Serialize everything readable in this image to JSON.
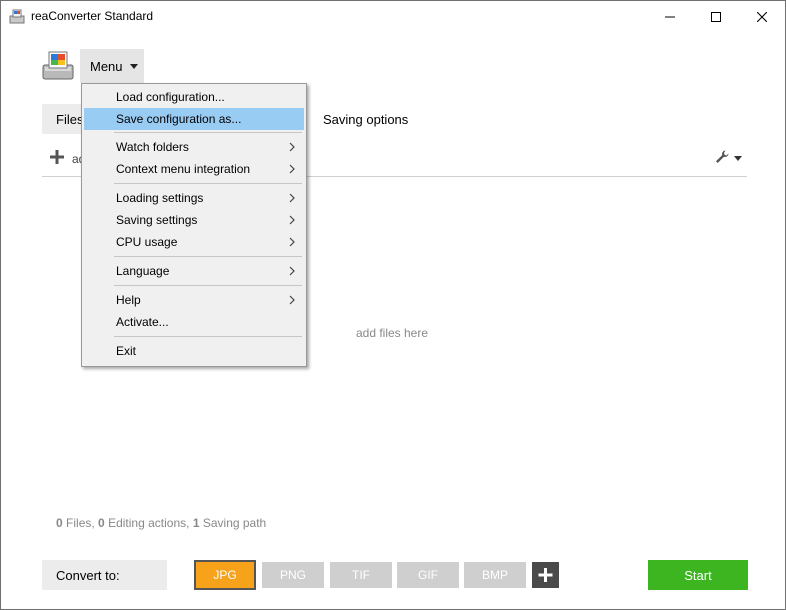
{
  "window": {
    "title": "reaConverter Standard"
  },
  "menu_button": {
    "label": "Menu"
  },
  "tabs": [
    {
      "label": "Files"
    },
    {
      "label": "Saving options"
    }
  ],
  "toolbar": {
    "add_label": "add"
  },
  "drop_area": {
    "hint": "add files here"
  },
  "status": {
    "files_count": "0",
    "files_label": "Files,",
    "actions_count": "0",
    "actions_label": "Editing actions,",
    "paths_count": "1",
    "paths_label": "Saving path"
  },
  "convert": {
    "label": "Convert to:",
    "formats": [
      "JPG",
      "PNG",
      "TIF",
      "GIF",
      "BMP"
    ],
    "selected": "JPG"
  },
  "start_button": {
    "label": "Start"
  },
  "dropdown": {
    "items": [
      {
        "label": "Load configuration..."
      },
      {
        "label": "Save configuration as..."
      },
      {
        "label": "Watch folders"
      },
      {
        "label": "Context menu integration"
      },
      {
        "label": "Loading settings"
      },
      {
        "label": "Saving settings"
      },
      {
        "label": "CPU usage"
      },
      {
        "label": "Language"
      },
      {
        "label": "Help"
      },
      {
        "label": "Activate..."
      },
      {
        "label": "Exit"
      }
    ]
  },
  "colors": {
    "accent_orange": "#f7a21b",
    "start_green": "#3cb521",
    "highlight_blue": "#99ccf3",
    "format_gray": "#cfcfcf"
  }
}
